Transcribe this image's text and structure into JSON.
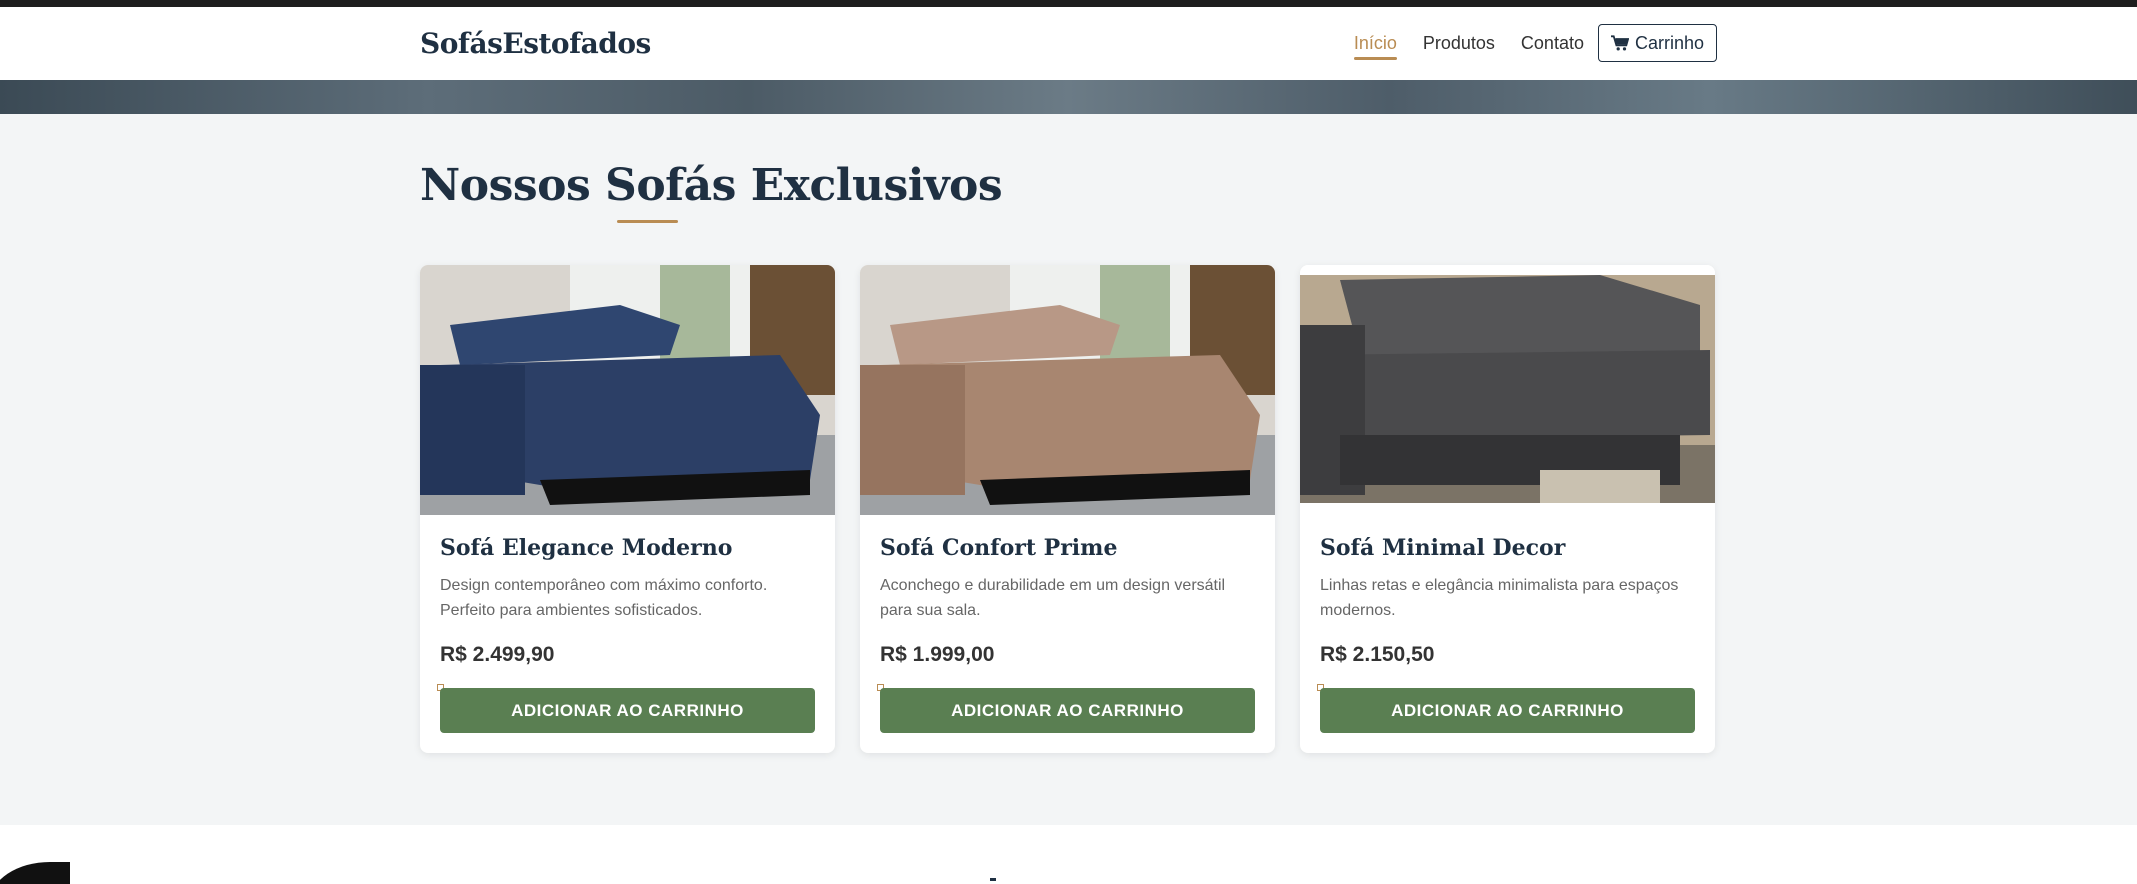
{
  "nav": {
    "brand": "SofásEstofados",
    "links": [
      "Início",
      "Produtos",
      "Contato"
    ],
    "cart_label": "Carrinho"
  },
  "section": {
    "title": "Nossos Sofás Exclusivos"
  },
  "products": [
    {
      "name": "Sofá Elegance Moderno",
      "description": "Design contemporâneo com máximo conforto. Perfeito para ambientes sofisticados.",
      "price": "R$ 2.499,90",
      "button": "ADICIONAR AO CARRINHO",
      "color": "#2c3f66"
    },
    {
      "name": "Sofá Confort Prime",
      "description": "Aconchego e durabilidade em um design versátil para sua sala.",
      "price": "R$ 1.999,00",
      "button": "ADICIONAR AO CARRINHO",
      "color": "#a88670"
    },
    {
      "name": "Sofá Minimal Decor",
      "description": "Linhas retas e elegância minimalista para espaços modernos.",
      "price": "R$ 2.150,50",
      "button": "ADICIONAR AO CARRINHO",
      "color": "#4a4a4c"
    }
  ],
  "colors": {
    "accent": "#b98c53",
    "primary": "#1f3042",
    "button": "#5a7f52"
  }
}
